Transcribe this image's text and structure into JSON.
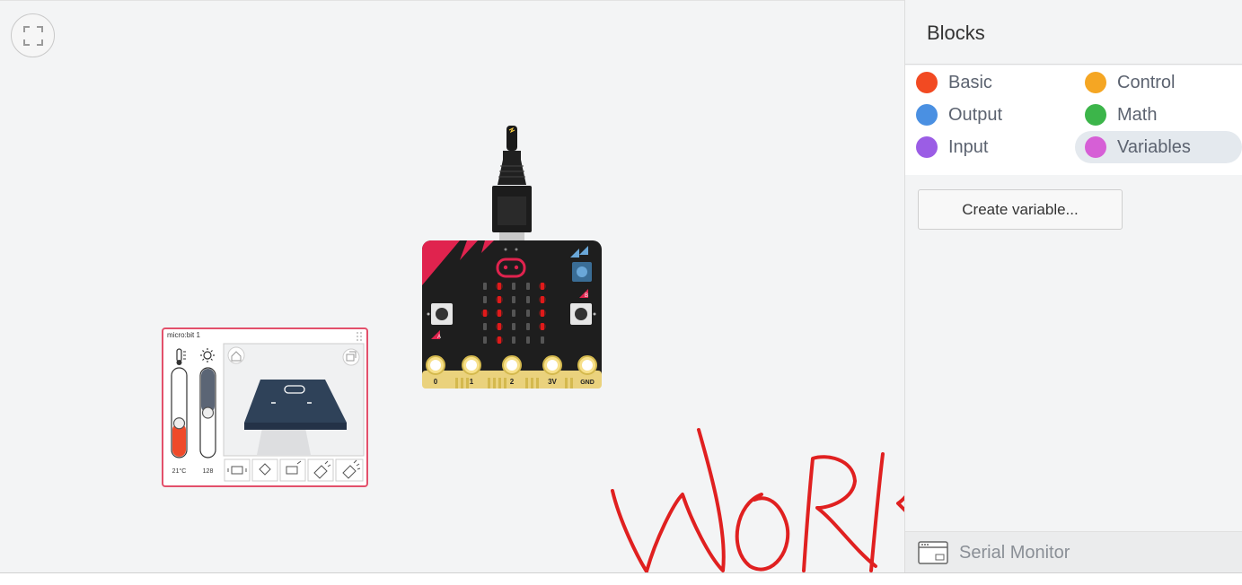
{
  "sidebar": {
    "title": "Blocks",
    "categories": [
      {
        "label": "Basic",
        "color": "#f24a22"
      },
      {
        "label": "Control",
        "color": "#f5a623"
      },
      {
        "label": "Output",
        "color": "#4a90e2"
      },
      {
        "label": "Math",
        "color": "#3cb54a"
      },
      {
        "label": "Input",
        "color": "#9b5de5"
      },
      {
        "label": "Variables",
        "color": "#d65fd6"
      }
    ],
    "create_variable_label": "Create variable...",
    "serial_monitor_label": "Serial Monitor"
  },
  "device": {
    "pin_labels": [
      "0",
      "1",
      "2",
      "3V",
      "GND"
    ],
    "button_a": "A",
    "button_b": "B",
    "board_color": "#1e1e1e",
    "led_color": "#e01b1b"
  },
  "simulator": {
    "title": "micro:bit 1",
    "temperature": "21°C",
    "temperature_level": 0.38,
    "light": "128",
    "light_level": 0.5
  },
  "annotation": {
    "text": "WORKING!",
    "color": "#e02020"
  }
}
